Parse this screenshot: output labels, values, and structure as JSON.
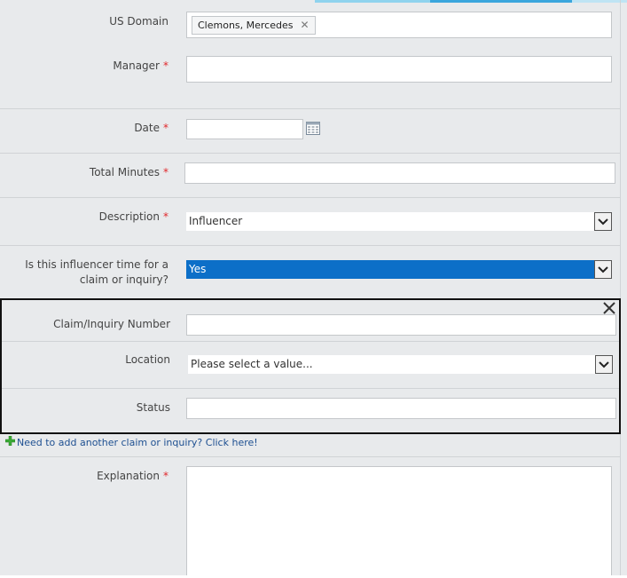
{
  "colors": {
    "background": "#e8eaec",
    "required": "#e0282c",
    "selected": "#0c6fc8",
    "link": "#1d4f91",
    "plus_icon": "#3aaa35"
  },
  "form": {
    "us_domain": {
      "label": "US Domain",
      "tag": "Clemons, Mercedes"
    },
    "manager": {
      "label": "Manager",
      "required": "*",
      "value": ""
    },
    "date": {
      "label": "Date",
      "required": "*",
      "value": ""
    },
    "total_minutes": {
      "label": "Total Minutes",
      "required": "*",
      "value": ""
    },
    "description": {
      "label": "Description",
      "required": "*",
      "selected": "Influencer"
    },
    "influencer": {
      "label_line1": "Is this influencer time for a",
      "label_line2": "claim or inquiry?",
      "selected": "Yes"
    },
    "claim_group": {
      "claim_number": {
        "label": "Claim/Inquiry Number",
        "value": ""
      },
      "location": {
        "label": "Location",
        "selected": "Please select a value..."
      },
      "status": {
        "label": "Status",
        "value": ""
      }
    },
    "add_link": "Need to add another claim or inquiry? Click here!",
    "explanation": {
      "label": "Explanation",
      "required": "*",
      "value": ""
    }
  }
}
